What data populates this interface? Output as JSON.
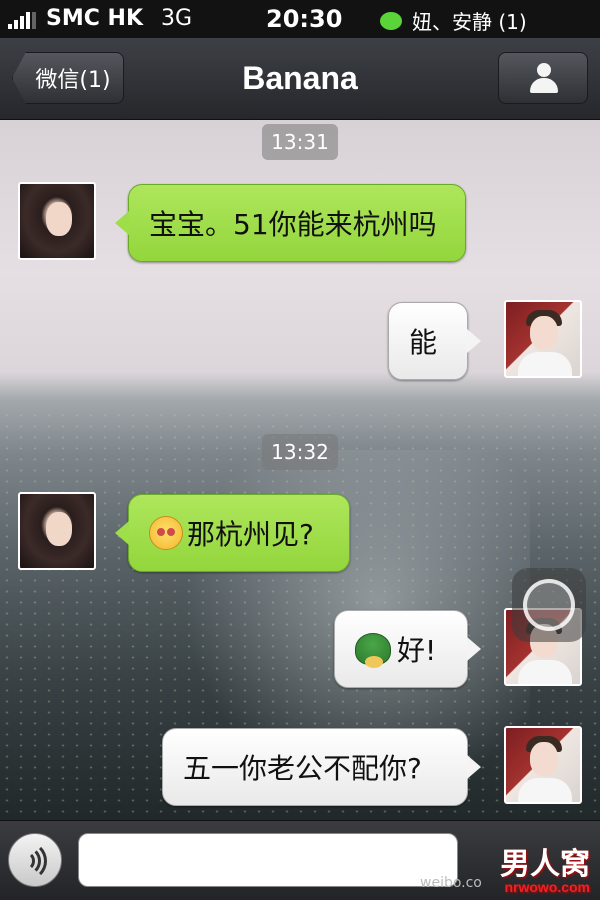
{
  "status_bar": {
    "carrier": "SMC HK",
    "network": "3G",
    "time": "20:30",
    "notification": "妞、安静 (1)"
  },
  "nav": {
    "back_label": "微信(1)",
    "title": "Banana",
    "profile_icon": "person-icon"
  },
  "messages": [
    {
      "time": "13:31"
    },
    {
      "sender": "Banana",
      "side": "left",
      "text": "宝宝。51你能来杭州吗"
    },
    {
      "sender": "me",
      "side": "right",
      "text": "能"
    },
    {
      "time": "13:32"
    },
    {
      "sender": "Banana",
      "side": "left",
      "emoji": "blushing-face",
      "text": "那杭州见?"
    },
    {
      "sender": "me",
      "side": "right",
      "emoji": "turtle",
      "text": "好!"
    },
    {
      "sender": "me",
      "side": "right",
      "text": "五一你老公不配你?"
    }
  ],
  "input_bar": {
    "voice_icon": "voice-icon",
    "watermark": "男人窝",
    "watermark_url": "nrwowo.com",
    "weibo": "weibo.co"
  },
  "colors": {
    "bubble_green": "#9ede48",
    "bubble_white": "#f4f4f4",
    "nav_dark": "#2e3035"
  }
}
